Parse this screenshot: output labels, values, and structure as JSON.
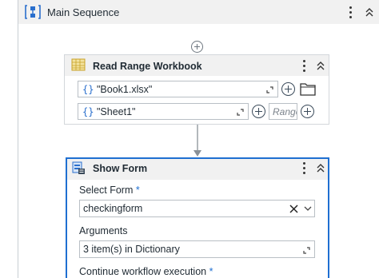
{
  "sequence": {
    "title": "Main Sequence"
  },
  "read_range": {
    "title": "Read Range Workbook",
    "workbook_value": "\"Book1.xlsx\"",
    "sheet_value": "\"Sheet1\"",
    "range_placeholder": "Range",
    "braces": "{}"
  },
  "show_form": {
    "title": "Show Form",
    "select_form_label": "Select Form",
    "select_form_value": "checkingform",
    "arguments_label": "Arguments",
    "arguments_value": "3 item(s) in Dictionary",
    "continue_label": "Continue workflow execution",
    "required_mark": "*"
  },
  "colors": {
    "accent": "#1f6fd1",
    "header_bg": "#f1f1f1",
    "excel_icon": "#c9a227"
  }
}
